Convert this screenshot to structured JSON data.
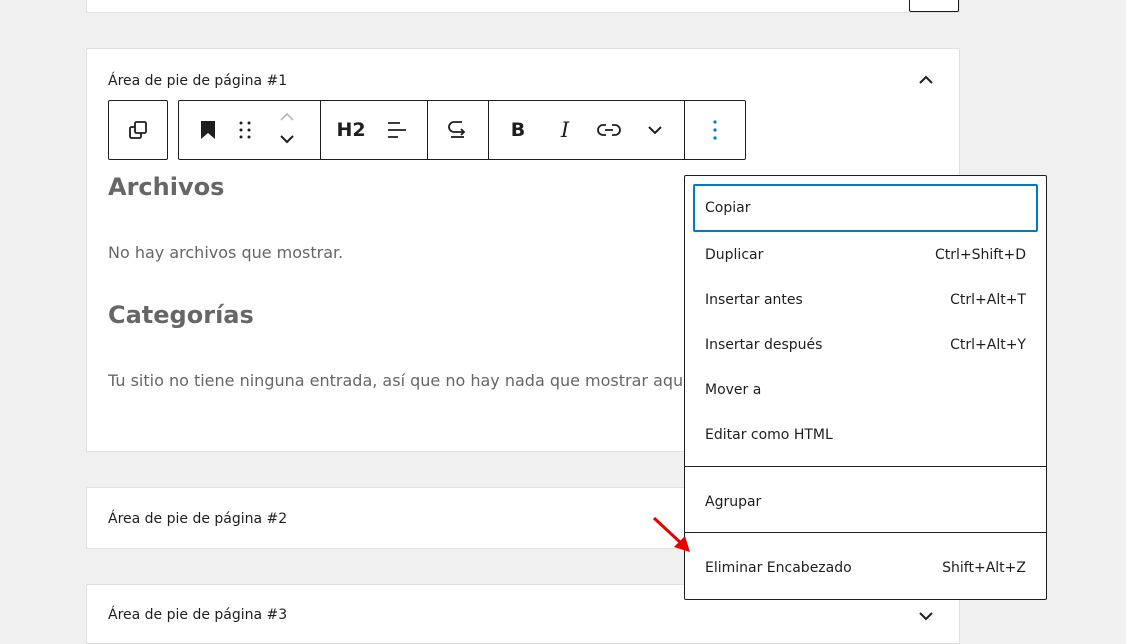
{
  "panels": {
    "footer1_title": "Área de pie de página #1",
    "footer2_title": "Área de pie de página #2",
    "footer3_title": "Área de pie de página #3"
  },
  "toolbar": {
    "heading_level": "H2",
    "bold": "B",
    "italic": "I"
  },
  "content": {
    "archives_heading": "Archivos",
    "archives_empty": "No hay archivos que mostrar.",
    "categories_heading": "Categorías",
    "categories_empty": "Tu sitio no tiene ninguna entrada, así que no hay nada que mostrar aquí."
  },
  "menu": {
    "items": [
      {
        "label": "Copiar",
        "shortcut": ""
      },
      {
        "label": "Duplicar",
        "shortcut": "Ctrl+Shift+D"
      },
      {
        "label": "Insertar antes",
        "shortcut": "Ctrl+Alt+T"
      },
      {
        "label": "Insertar después",
        "shortcut": "Ctrl+Alt+Y"
      },
      {
        "label": "Mover a",
        "shortcut": ""
      },
      {
        "label": "Editar como HTML",
        "shortcut": ""
      }
    ],
    "group_label": "Agrupar",
    "remove_label": "Eliminar Encabezado",
    "remove_shortcut": "Shift+Alt+Z"
  },
  "colors": {
    "focus": "#007cba",
    "text_muted": "#666666",
    "annotation_arrow": "#e60000"
  }
}
